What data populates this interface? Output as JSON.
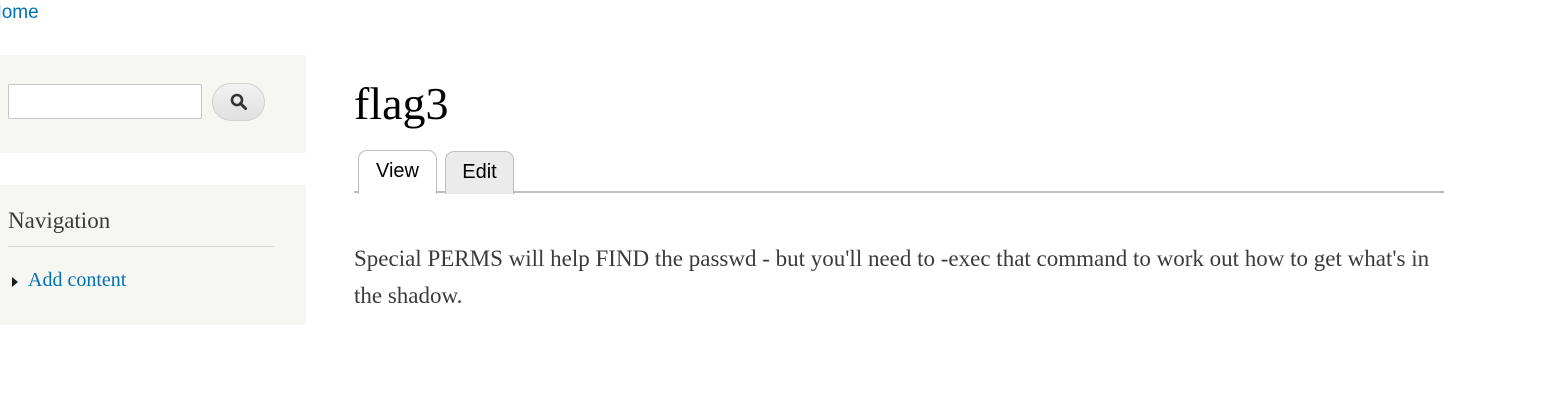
{
  "header": {
    "home_link": "Home"
  },
  "sidebar": {
    "search": {
      "input_value": "",
      "button_icon": "search-icon"
    },
    "navigation": {
      "title": "Navigation",
      "items": [
        {
          "label": "Add content",
          "icon": "triangle-right-icon"
        }
      ]
    }
  },
  "main": {
    "title": "flag3",
    "tabs": [
      {
        "label": "View",
        "active": true
      },
      {
        "label": "Edit",
        "active": false
      }
    ],
    "body": "Special PERMS will help FIND the passwd - but you'll need to -exec that command to work out how to get what's in the shadow."
  },
  "colors": {
    "link": "#0071b3",
    "sidebar_bg": "#f6f6f2",
    "text": "#3b3b3b",
    "title": "#000000"
  }
}
